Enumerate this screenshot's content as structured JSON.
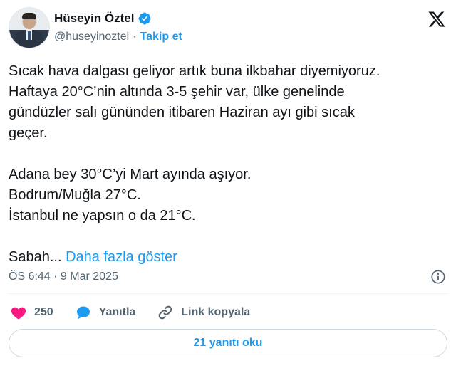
{
  "author": {
    "name": "Hüseyin Öztel",
    "handle": "@huseyinoztel",
    "separator": "·",
    "follow_label": "Takip et"
  },
  "tweet": {
    "line1": "Sıcak hava dalgası geliyor artık buna ilkbahar diyemiyoruz.",
    "line2": "Haftaya 20°C’nin altında 3-5 şehir var, ülke genelinde",
    "line3": "gündüzler salı gününden itibaren Haziran ayı gibi sıcak",
    "line4": "geçer.",
    "line5": "Adana bey 30°C’yi Mart ayında aşıyor.",
    "line6": "Bodrum/Muğla 27°C.",
    "line7": "İstanbul ne yapsın o da 21°C.",
    "line8": "Sabah...",
    "show_more": "Daha fazla göster",
    "timestamp": "ÖS 6:44 · 9 Mar 2025"
  },
  "actions": {
    "like_count": "250",
    "reply_label": "Yanıtla",
    "copy_link_label": "Link kopyala"
  },
  "read_replies_label": "21 yanıtı oku",
  "icons": {
    "verified": "verified-badge-icon",
    "logo": "x-logo-icon",
    "info": "info-icon",
    "heart": "heart-icon",
    "reply": "reply-bubble-icon",
    "link": "link-icon"
  },
  "colors": {
    "accent": "#1d9bf0",
    "heart": "#f91880",
    "text": "#0f1419",
    "muted": "#536471"
  }
}
